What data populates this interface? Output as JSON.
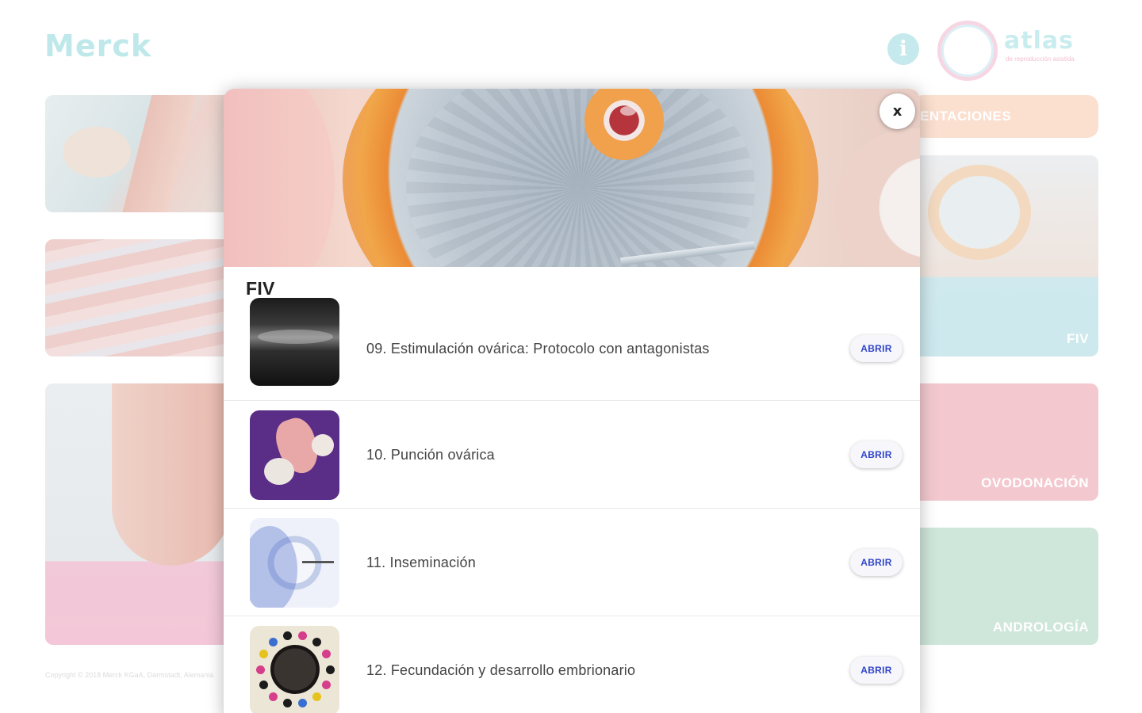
{
  "header": {
    "brand_logo": "Merck",
    "info_icon": "i",
    "atlas_word": "atlas",
    "atlas_sub": "de reproducción asistida"
  },
  "background_cards": {
    "top_right_pill": "ENTACIONES",
    "fiv_label": "FIV",
    "ovodonacion_label": "OVODONACIÓN",
    "andrologia_label": "ANDROLOGÍA",
    "footer_text": "Copyright © 2018 Merck KGaA, Darmstadt, Alemania"
  },
  "modal": {
    "title": "FIV",
    "close_label": "x",
    "items": [
      {
        "title": "09. Estimulación ovárica: Protocolo con antagonistas",
        "button": "ABRIR",
        "thumb_icon": "ultrasound-thumbnail"
      },
      {
        "title": "10. Punción ovárica",
        "button": "ABRIR",
        "thumb_icon": "ovary-illustration-thumbnail"
      },
      {
        "title": "11. Inseminación",
        "button": "ABRIR",
        "thumb_icon": "oocyte-injection-thumbnail"
      },
      {
        "title": "12. Fecundación y desarrollo embrionario",
        "button": "ABRIR",
        "thumb_icon": "embryo-thumbnail"
      }
    ]
  },
  "colors": {
    "accent_button_text": "#3146c9",
    "modal_background": "#ffffff",
    "fiv_card": "#cde9ee",
    "ovodonacion_card": "#f3c9cf",
    "andrologia_card": "#cfe6db",
    "pill": "#fbdfcf"
  }
}
